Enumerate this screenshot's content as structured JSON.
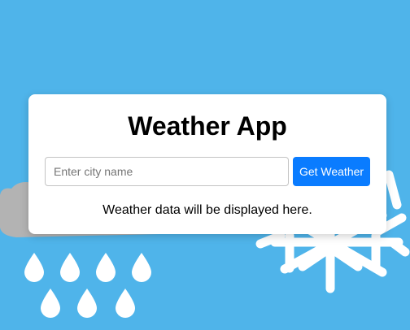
{
  "app": {
    "title": "Weather App"
  },
  "search": {
    "placeholder": "Enter city name",
    "value": "",
    "button_label": "Get Weather"
  },
  "output": {
    "text": "Weather data will be displayed here."
  },
  "background": {
    "decorations": [
      "cloud-icon",
      "raindrop-icon",
      "snowflake-icon"
    ]
  },
  "colors": {
    "background": "#4fb4ea",
    "card": "#ffffff",
    "button": "#0a7cff",
    "decoration": "#ffffff",
    "cloud": "#b5b5b5"
  }
}
